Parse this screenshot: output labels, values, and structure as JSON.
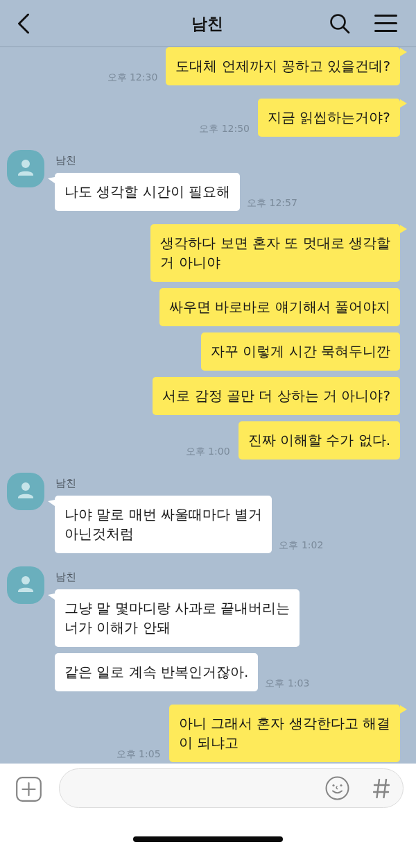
{
  "header": {
    "title": "남친"
  },
  "chat": [
    {
      "kind": "sent",
      "bubbles": [
        {
          "text": "도대체 언제까지 꽁하고 있을건데?",
          "time": "오후 12:30"
        }
      ]
    },
    {
      "kind": "sent",
      "bubbles": [
        {
          "text": "지금 읽씹하는거야?",
          "time": "오후 12:50"
        }
      ]
    },
    {
      "kind": "received",
      "sender": "남친",
      "bubbles": [
        {
          "text": "나도 생각할 시간이 필요해",
          "time": "오후 12:57"
        }
      ]
    },
    {
      "kind": "sent",
      "bubbles": [
        {
          "text": "생각하다 보면 혼자 또 멋대로 생각할\n거 아니야"
        },
        {
          "text": "싸우면 바로바로 얘기해서 풀어야지"
        },
        {
          "text": "자꾸 이렇게 시간 묵혀두니깐"
        },
        {
          "text": "서로 감정 골만 더 상하는 거 아니야?"
        },
        {
          "text": "진짜 이해할 수가 없다.",
          "time": "오후 1:00"
        }
      ]
    },
    {
      "kind": "received",
      "sender": "남친",
      "bubbles": [
        {
          "text": "나야 말로 매번 싸울때마다 별거\n아닌것처럼",
          "time": "오후 1:02"
        }
      ]
    },
    {
      "kind": "received",
      "sender": "남친",
      "bubbles": [
        {
          "text": "그냥 말 몇마디랑 사과로 끝내버리는\n너가 이해가 안돼"
        },
        {
          "text": "같은 일로 계속 반복인거잖아.",
          "time": "오후 1:03"
        }
      ]
    },
    {
      "kind": "sent",
      "bubbles": [
        {
          "text": "아니 그래서 혼자 생각한다고 해결\n이 되냐고",
          "time": "오후 1:05"
        }
      ]
    }
  ]
}
